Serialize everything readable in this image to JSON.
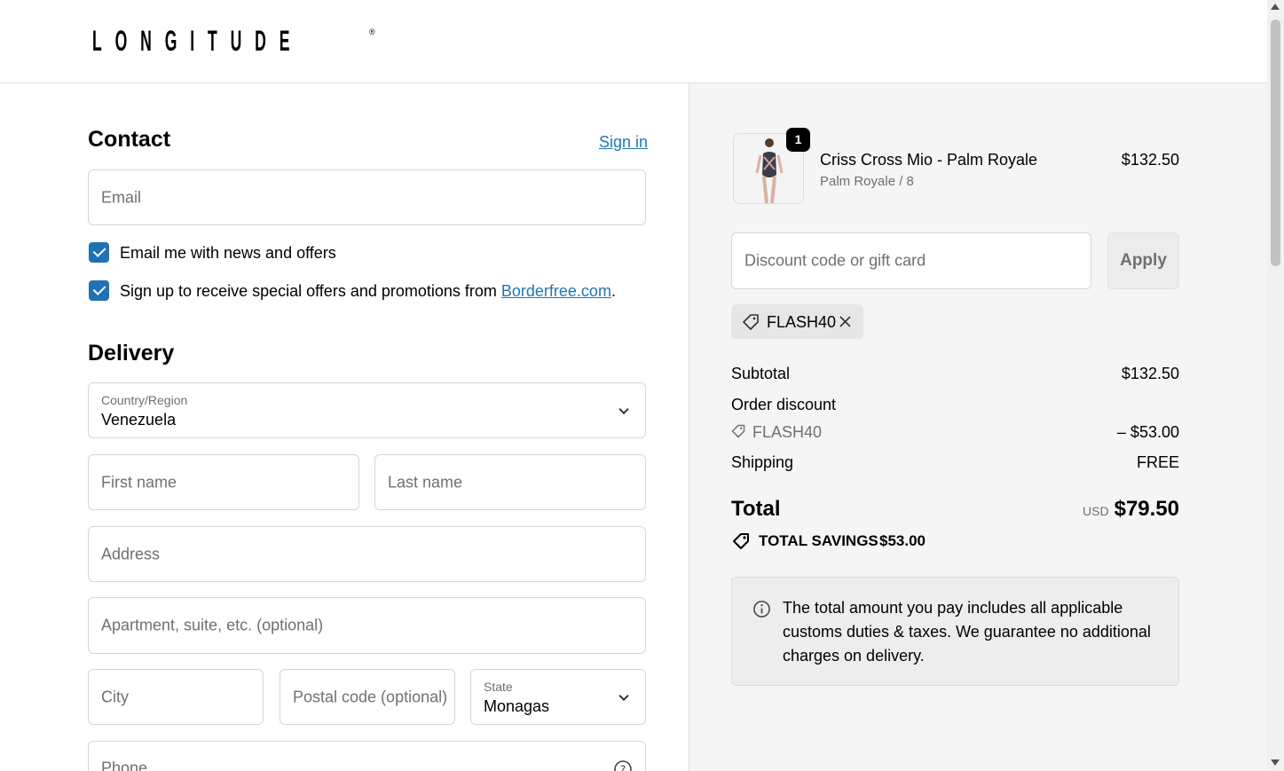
{
  "brand": {
    "logo": "LONGITUDE",
    "reg_mark": "®"
  },
  "contact": {
    "title": "Contact",
    "sign_in": "Sign in",
    "email_placeholder": "Email",
    "news_checkbox": "Email me with news and offers",
    "offers_checkbox_prefix": "Sign up to receive special offers and promotions from ",
    "offers_link": "Borderfree.com",
    "offers_suffix": "."
  },
  "delivery": {
    "title": "Delivery",
    "country_label": "Country/Region",
    "country_value": "Venezuela",
    "first_name": "First name",
    "last_name": "Last name",
    "address": "Address",
    "apartment": "Apartment, suite, etc. (optional)",
    "city": "City",
    "postal": "Postal code (optional)",
    "state_label": "State",
    "state_value": "Monagas",
    "phone": "Phone"
  },
  "cart": {
    "item": {
      "name": "Criss Cross Mio - Palm Royale",
      "variant": "Palm Royale / 8",
      "price": "$132.50",
      "quantity": "1"
    },
    "discount_placeholder": "Discount code or gift card",
    "apply_label": "Apply",
    "applied_code": "FLASH40",
    "subtotal_label": "Subtotal",
    "subtotal_value": "$132.50",
    "order_discount_label": "Order discount",
    "order_discount_code": "FLASH40",
    "order_discount_value": "– $53.00",
    "shipping_label": "Shipping",
    "shipping_value": "FREE",
    "total_label": "Total",
    "currency": "USD",
    "total_value": "$79.50",
    "savings_label": "TOTAL SAVINGS",
    "savings_value": "$53.00",
    "info_text": "The total amount you pay includes all applicable customs duties & taxes. We guarantee no additional charges on delivery."
  },
  "colors": {
    "accent": "#1e73b4",
    "panel": "#f5f5f5",
    "border": "#dedede"
  }
}
